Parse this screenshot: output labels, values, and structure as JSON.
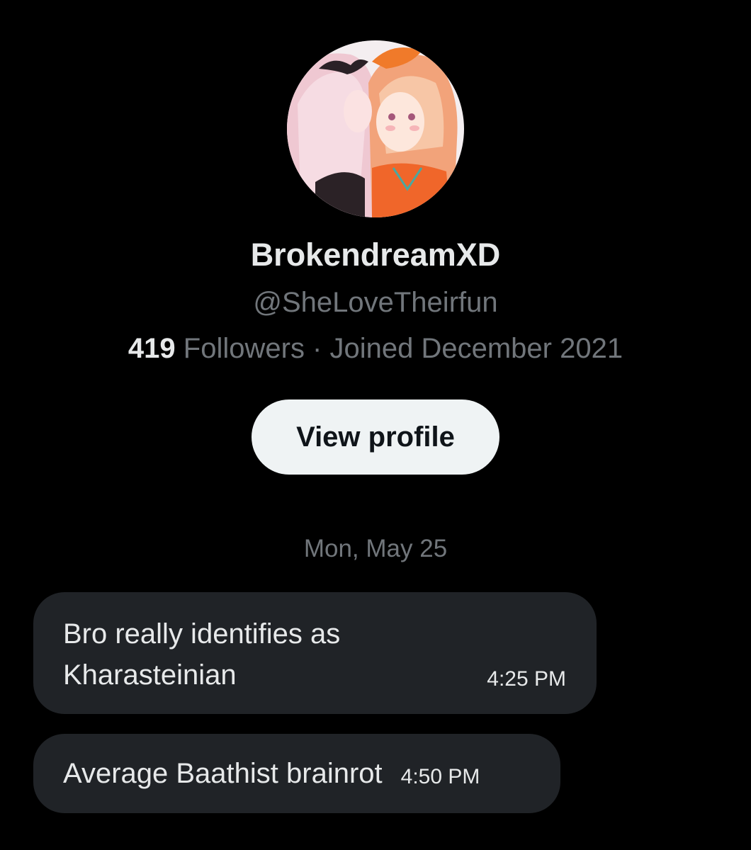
{
  "profile": {
    "avatar_icon": "user-avatar-illustration",
    "display_name": "BrokendreamXD",
    "handle": "@SheLoveTheirfun",
    "followers_count": "419",
    "followers_label": " Followers · Joined December 2021",
    "view_profile_label": "View profile"
  },
  "conversation": {
    "date_separator": "Mon, May 25",
    "messages": [
      {
        "text": "Bro really identifies as Kharasteinian",
        "time": "4:25 PM"
      },
      {
        "text": "Average Baathist brainrot",
        "time": "4:50 PM"
      }
    ]
  },
  "colors": {
    "background": "#000000",
    "bubble": "#202327",
    "primary_text": "#e7e9ea",
    "secondary_text": "#71767b",
    "button_bg": "#eff3f4"
  }
}
